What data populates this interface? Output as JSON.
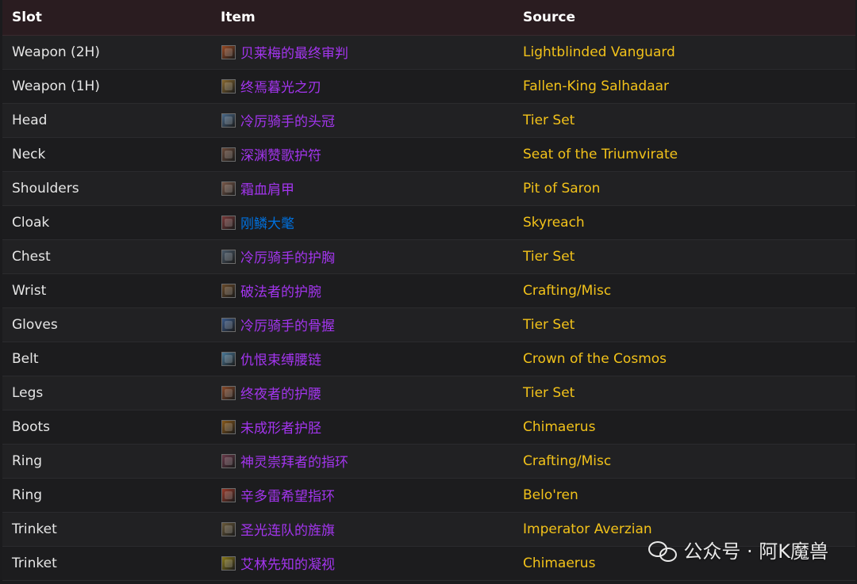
{
  "table": {
    "headers": [
      "Slot",
      "Item",
      "Source"
    ],
    "rows": [
      {
        "slot": "Weapon (2H)",
        "item": "贝莱梅的最终审判",
        "source": "Lightblinded Vanguard",
        "icon": "weapon-2h-icon",
        "item_color": "#a335ee",
        "icon_color": "#9a4a25"
      },
      {
        "slot": "Weapon (1H)",
        "item": "终焉暮光之刃",
        "source": "Fallen-King Salhadaar",
        "icon": "weapon-1h-icon",
        "item_color": "#a335ee",
        "icon_color": "#8a6a30"
      },
      {
        "slot": "Head",
        "item": "冷厉骑手的头冠",
        "source": "Tier Set",
        "icon": "helm-icon",
        "item_color": "#a335ee",
        "icon_color": "#4a6a8a"
      },
      {
        "slot": "Neck",
        "item": "深渊赞歌护符",
        "source": "Seat of the Triumvirate",
        "icon": "neck-icon",
        "item_color": "#a335ee",
        "icon_color": "#6a4a3a"
      },
      {
        "slot": "Shoulders",
        "item": "霜血肩甲",
        "source": "Pit of Saron",
        "icon": "shoulder-icon",
        "item_color": "#a335ee",
        "icon_color": "#7a5a4a"
      },
      {
        "slot": "Cloak",
        "item": "刚鳞大氅",
        "source": "Skyreach",
        "icon": "cloak-icon",
        "item_color": "#0070dd",
        "icon_color": "#7a3a3a"
      },
      {
        "slot": "Chest",
        "item": "冷厉骑手的护胸",
        "source": "Tier Set",
        "icon": "chest-icon",
        "item_color": "#a335ee",
        "icon_color": "#4a5a6a"
      },
      {
        "slot": "Wrist",
        "item": "破法者的护腕",
        "source": "Crafting/Misc",
        "icon": "wrist-icon",
        "item_color": "#a335ee",
        "icon_color": "#6a4a2a"
      },
      {
        "slot": "Gloves",
        "item": "冷厉骑手的骨握",
        "source": "Tier Set",
        "icon": "gloves-icon",
        "item_color": "#a335ee",
        "icon_color": "#3a5a8a"
      },
      {
        "slot": "Belt",
        "item": "仇恨束缚腰链",
        "source": "Crown of the Cosmos",
        "icon": "belt-icon",
        "item_color": "#a335ee",
        "icon_color": "#4a7a9a"
      },
      {
        "slot": "Legs",
        "item": "终夜者的护腰",
        "source": "Tier Set",
        "icon": "legs-icon",
        "item_color": "#a335ee",
        "icon_color": "#8a4a2a"
      },
      {
        "slot": "Boots",
        "item": "未成形者护胫",
        "source": "Chimaerus",
        "icon": "boots-icon",
        "item_color": "#a335ee",
        "icon_color": "#8a5a1a"
      },
      {
        "slot": "Ring",
        "item": "神灵崇拜者的指环",
        "source": "Crafting/Misc",
        "icon": "ring-icon",
        "item_color": "#a335ee",
        "icon_color": "#6a3a4a"
      },
      {
        "slot": "Ring",
        "item": "辛多雷希望指环",
        "source": "Belo'ren",
        "icon": "ring-icon",
        "item_color": "#a335ee",
        "icon_color": "#9a3a2a"
      },
      {
        "slot": "Trinket",
        "item": "圣光连队的旌旗",
        "source": "Imperator Averzian",
        "icon": "trinket-banner-icon",
        "item_color": "#a335ee",
        "icon_color": "#6a5a3a"
      },
      {
        "slot": "Trinket",
        "item": "艾林先知的凝视",
        "source": "Chimaerus",
        "icon": "trinket-eye-icon",
        "item_color": "#a335ee",
        "icon_color": "#8a7a1a"
      }
    ]
  },
  "watermark": {
    "text": "公众号 · 阿K魔兽"
  },
  "colors": {
    "header_bg": "#2a1c20",
    "source_text": "#f2c21a",
    "epic_item": "#a335ee",
    "rare_item": "#0070dd"
  }
}
